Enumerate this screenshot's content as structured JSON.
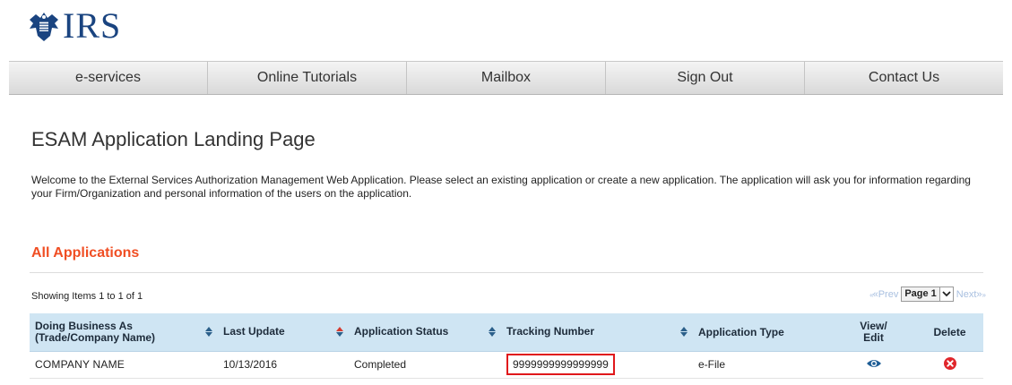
{
  "header": {
    "logo_text": "IRS",
    "logo_emblem": "eagle-emblem-icon"
  },
  "nav": {
    "items": [
      {
        "label": "e-services"
      },
      {
        "label": "Online Tutorials"
      },
      {
        "label": "Mailbox"
      },
      {
        "label": "Sign Out"
      },
      {
        "label": "Contact Us"
      }
    ]
  },
  "page": {
    "title": "ESAM Application Landing Page",
    "intro": "Welcome to the External Services Authorization Management Web Application. Please select an existing application or create a new application. The application will ask you for information regarding your Firm/Organization and personal information of the users on the application."
  },
  "applications": {
    "section_title": "All Applications",
    "showing": "Showing Items 1 to 1 of 1",
    "pager": {
      "prev_label": "«Prev",
      "page_label": "Page 1",
      "next_label": "Next»"
    },
    "columns": [
      {
        "label": "Doing Business As (Trade/Company Name)",
        "sortable": true
      },
      {
        "label": "Last Update",
        "sortable": true,
        "sort_active": true
      },
      {
        "label": "Application Status",
        "sortable": true
      },
      {
        "label": "Tracking Number",
        "sortable": true
      },
      {
        "label": "Application Type",
        "sortable": false
      },
      {
        "label": "View/ Edit",
        "sortable": false
      },
      {
        "label": "Delete",
        "sortable": false
      }
    ],
    "rows": [
      {
        "company": "COMPANY NAME",
        "last_update": "10/13/2016",
        "status": "Completed",
        "tracking_number": "9999999999999999",
        "type": "e-File",
        "view_icon": "eye-icon",
        "delete_icon": "delete-x-icon"
      }
    ]
  },
  "colors": {
    "brand_blue": "#1a4480",
    "accent_orange": "#f04e23",
    "table_header_bg": "#cfe5f3",
    "highlight_red": "#e0181b",
    "pager_link": "#a9c0e0"
  }
}
